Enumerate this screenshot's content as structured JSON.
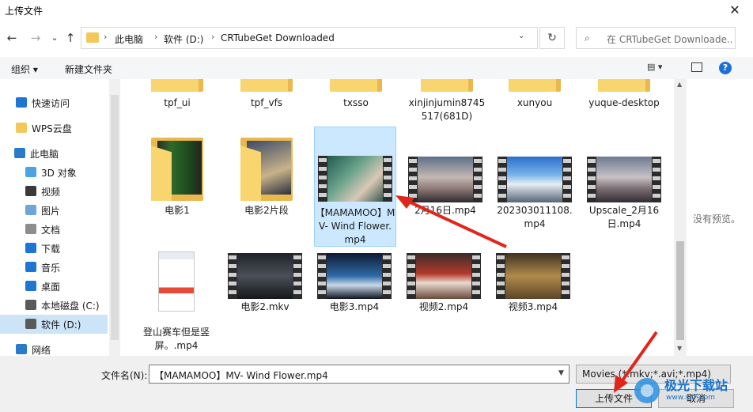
{
  "window": {
    "title": "上传文件",
    "close": "✕"
  },
  "nav": {
    "back": "←",
    "forward": "→",
    "up_history": "⌄",
    "up": "↑",
    "refresh": "↻"
  },
  "address": {
    "crumbs": [
      "此电脑",
      "软件 (D:)",
      "CRTubeGet Downloaded"
    ],
    "sep": "›",
    "dropdown": "⌄"
  },
  "search": {
    "icon": "⌕",
    "placeholder": "在 CRTubeGet Downloade..."
  },
  "toolbar": {
    "organize": "组织 ▾",
    "new_folder": "新建文件夹",
    "view": "▤ ▾",
    "help": "?"
  },
  "sidebar": {
    "items": [
      {
        "label": "快速访问",
        "icon": "star-icon",
        "color": "#1e76d2"
      },
      {
        "label": "WPS云盘",
        "icon": "folder-icon",
        "color": "#f3c85a"
      },
      {
        "label": "此电脑",
        "icon": "computer-icon",
        "color": "#2b79c9"
      },
      {
        "label": "3D 对象",
        "icon": "cube-icon",
        "color": "#4ba3e3"
      },
      {
        "label": "视频",
        "icon": "video-icon",
        "color": "#3a3a3a"
      },
      {
        "label": "图片",
        "icon": "picture-icon",
        "color": "#6fa6d9"
      },
      {
        "label": "文档",
        "icon": "document-icon",
        "color": "#8d8d8d"
      },
      {
        "label": "下载",
        "icon": "download-icon",
        "color": "#1e76d2"
      },
      {
        "label": "音乐",
        "icon": "music-icon",
        "color": "#1e76d2"
      },
      {
        "label": "桌面",
        "icon": "desktop-icon",
        "color": "#1e76d2"
      },
      {
        "label": "本地磁盘 (C:)",
        "icon": "drive-icon",
        "color": "#5a5a5a"
      },
      {
        "label": "软件 (D:)",
        "icon": "drive-icon",
        "color": "#5a5a5a"
      },
      {
        "label": "网络",
        "icon": "network-icon",
        "color": "#2b79c9"
      }
    ]
  },
  "files": {
    "row1": [
      "tpf_ui",
      "tpf_vfs",
      "txsso",
      "xinjinjumin8745517(681D)",
      "xunyou",
      "yuque-desktop"
    ],
    "row2": [
      "电影1",
      "电影2片段",
      "【MAMAMOO】MV- Wind Flower.mp4",
      "2月16日.mp4",
      "202303011108.mp4",
      "Upscale_2月16日.mp4"
    ],
    "row3": [
      "登山赛车但是竖屏。.mp4",
      "电影2.mkv",
      "电影3.mp4",
      "视频2.mp4",
      "视频3.mp4"
    ]
  },
  "preview": {
    "text": "没有预览。"
  },
  "bottom": {
    "filename_label": "文件名(N):",
    "filename_value": "【MAMAMOO】MV- Wind Flower.mp4",
    "filetype": "Movies (*.mkv;*.avi;*.mp4)",
    "upload": "上传文件",
    "cancel": "取消"
  },
  "watermark": {
    "text": "极光下载站",
    "sub": "www.xz7.com"
  },
  "colors": {
    "selection": "#cce8ff",
    "accent": "#0078d7",
    "arrow": "#e0261b"
  }
}
